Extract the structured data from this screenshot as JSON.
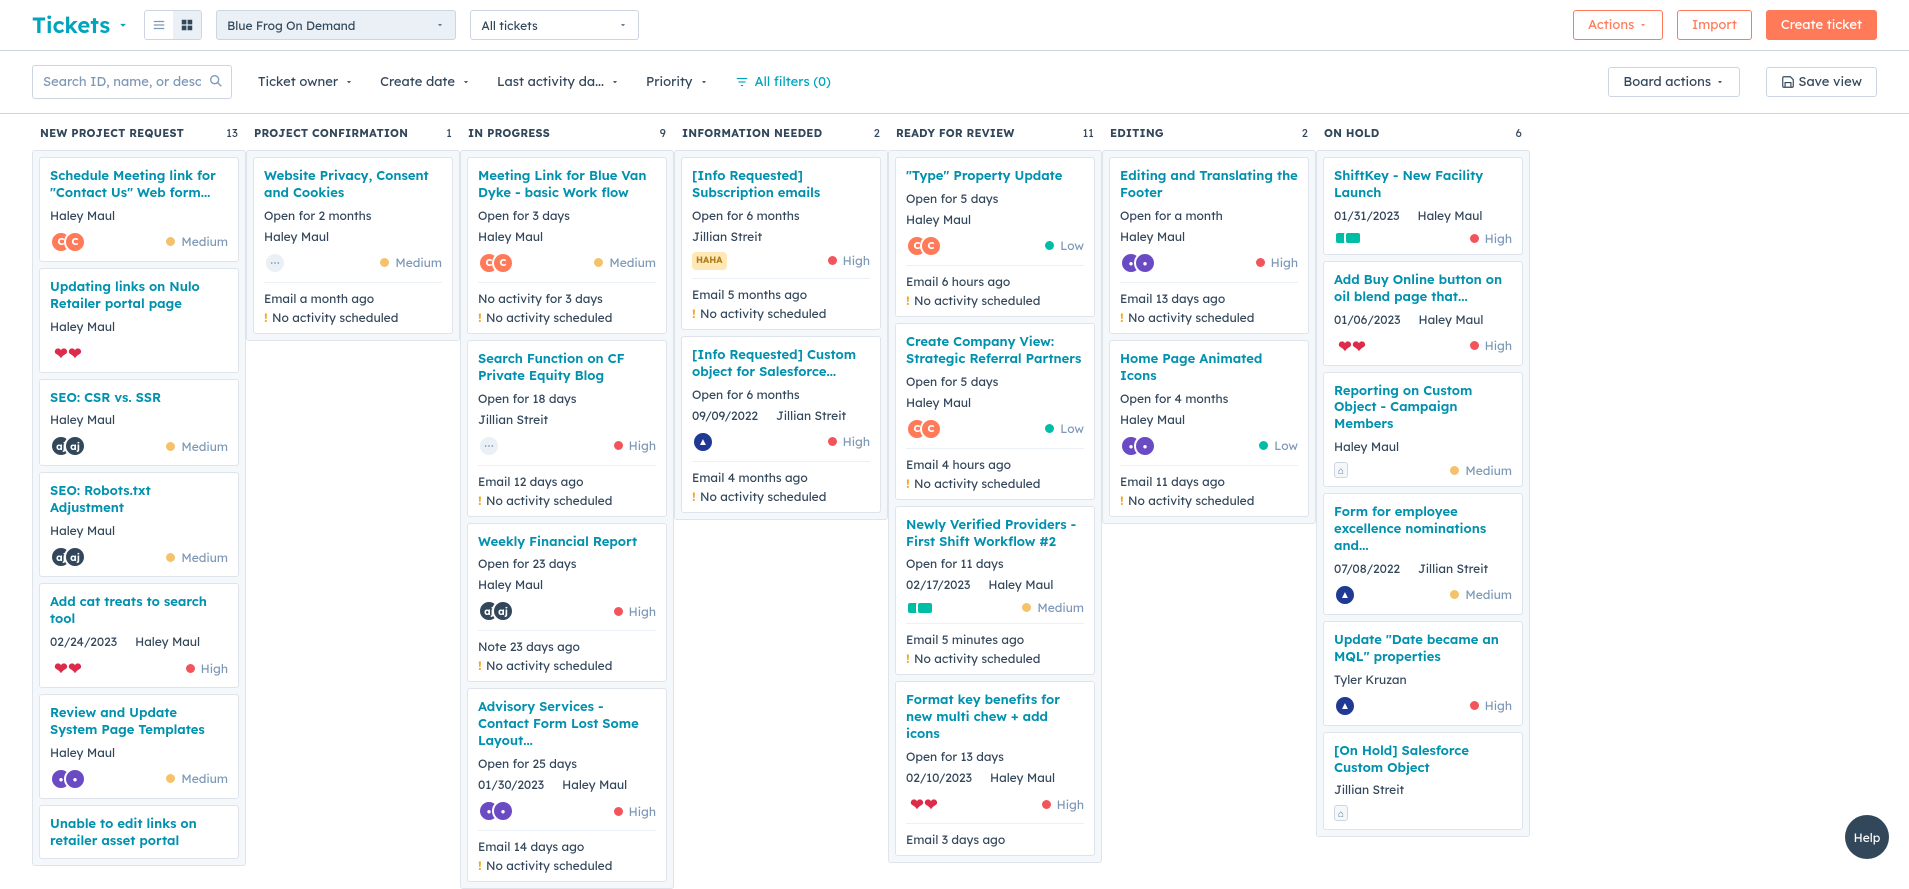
{
  "header": {
    "page_title": "Tickets",
    "pipeline_select": "Blue Frog On Demand",
    "view_select": "All tickets",
    "actions_label": "Actions",
    "import_label": "Import",
    "create_label": "Create ticket"
  },
  "filters": {
    "search_placeholder": "Search ID, name, or description",
    "owner": "Ticket owner",
    "create": "Create date",
    "activity": "Last activity da...",
    "priority": "Priority",
    "all_filters": "All filters (0)",
    "board_actions": "Board actions",
    "save_view": "Save view"
  },
  "columns": [
    {
      "name": "NEW PROJECT REQUEST",
      "count": 13,
      "cards": [
        {
          "title": "Schedule Meeting link for \"Contact Us\" Web form...",
          "line": "Haley Maul",
          "assoc": [
            {
              "t": "orangeC",
              "txt": "C"
            },
            {
              "t": "orangeC",
              "txt": "C"
            }
          ],
          "priority": "Medium"
        },
        {
          "title": "Updating links on Nulo Retailer portal page",
          "line": "Haley Maul",
          "assoc": [
            {
              "t": "heart",
              "txt": "❤"
            },
            {
              "t": "heart",
              "txt": "❤"
            }
          ]
        },
        {
          "title": "SEO: CSR vs. SSR",
          "line": "Haley Maul",
          "assoc": [
            {
              "t": "navyAJ",
              "txt": "aj"
            },
            {
              "t": "navyAJ",
              "txt": "aj"
            }
          ],
          "priority": "Medium"
        },
        {
          "title": "SEO: Robots.txt Adjustment",
          "line": "Haley Maul",
          "assoc": [
            {
              "t": "navyAJ",
              "txt": "aj"
            },
            {
              "t": "navyAJ",
              "txt": "aj"
            }
          ],
          "priority": "Medium"
        },
        {
          "title": "Add cat treats to search tool",
          "line2": [
            "02/24/2023",
            "Haley Maul"
          ],
          "assoc": [
            {
              "t": "heart",
              "txt": "❤"
            },
            {
              "t": "heart",
              "txt": "❤"
            }
          ],
          "priority": "High"
        },
        {
          "title": "Review and Update System Page Templates",
          "line": "Haley Maul",
          "assoc": [
            {
              "t": "purple",
              "txt": "●"
            },
            {
              "t": "purple",
              "txt": "●"
            }
          ],
          "priority": "Medium"
        },
        {
          "title": "Unable to edit links on retailer asset portal"
        }
      ]
    },
    {
      "name": "PROJECT CONFIRMATION",
      "count": 1,
      "cards": [
        {
          "title": "Website Privacy, Consent and Cookies",
          "line": "Open for 2 months",
          "line_b": "Haley Maul",
          "assoc": [
            {
              "t": "grey",
              "txt": "⋯"
            }
          ],
          "priority": "Medium",
          "meta": [
            "Email a month ago",
            "No activity scheduled"
          ]
        }
      ]
    },
    {
      "name": "IN PROGRESS",
      "count": 9,
      "cards": [
        {
          "title": "Meeting Link for Blue Van Dyke - basic Work flow",
          "line": "Open for 3 days",
          "line_b": "Haley Maul",
          "assoc": [
            {
              "t": "orangeC",
              "txt": "C"
            },
            {
              "t": "orangeC",
              "txt": "C"
            }
          ],
          "priority": "Medium",
          "meta": [
            "No activity for 3 days",
            "No activity scheduled"
          ]
        },
        {
          "title": "Search Function on CF Private Equity Blog",
          "line": "Open for 18 days",
          "line_b": "Jillian Streit",
          "assoc": [
            {
              "t": "grey",
              "txt": "⋯"
            }
          ],
          "priority": "High",
          "meta": [
            "Email 12 days ago",
            "No activity scheduled"
          ]
        },
        {
          "title": "Weekly Financial Report",
          "line": "Open for 23 days",
          "line_b": "Haley Maul",
          "assoc": [
            {
              "t": "navyAJ",
              "txt": "aj"
            },
            {
              "t": "navyAJ",
              "txt": "aj"
            }
          ],
          "priority": "High",
          "meta": [
            "Note 23 days ago",
            "No activity scheduled"
          ]
        },
        {
          "title": "Advisory Services - Contact Form Lost Some Layout...",
          "line": "Open for 25 days",
          "line2": [
            "01/30/2023",
            "Haley Maul"
          ],
          "assoc": [
            {
              "t": "purple",
              "txt": "●"
            },
            {
              "t": "purple",
              "txt": "●"
            }
          ],
          "priority": "High",
          "meta": [
            "Email 14 days ago",
            "No activity scheduled"
          ]
        }
      ]
    },
    {
      "name": "INFORMATION NEEDED",
      "count": 2,
      "cards": [
        {
          "title": "[Info Requested] Subscription emails",
          "line": "Open for 6 months",
          "line_b": "Jillian Streit",
          "assoc": [
            {
              "t": "haha",
              "txt": "HAHA"
            }
          ],
          "priority": "High",
          "meta": [
            "Email 5 months ago",
            "No activity scheduled"
          ]
        },
        {
          "title": "[Info Requested] Custom object for Salesforce...",
          "line": "Open for 6 months",
          "line2": [
            "09/09/2022",
            "Jillian Streit"
          ],
          "assoc": [
            {
              "t": "blueM",
              "txt": "▲"
            }
          ],
          "priority": "High",
          "meta": [
            "Email 4 months ago",
            "No activity scheduled"
          ]
        }
      ]
    },
    {
      "name": "READY FOR REVIEW",
      "count": 11,
      "cards": [
        {
          "title": "\"Type\" Property Update",
          "line": "Open for 5 days",
          "line_b": "Haley Maul",
          "assoc": [
            {
              "t": "orangeC",
              "txt": "C"
            },
            {
              "t": "orangeC",
              "txt": "C"
            }
          ],
          "priority": "Low",
          "meta": [
            "Email 6 hours ago",
            "No activity scheduled"
          ]
        },
        {
          "title": "Create Company View: Strategic Referral Partners",
          "line": "Open for 5 days",
          "line_b": "Haley Maul",
          "assoc": [
            {
              "t": "orangeC",
              "txt": "C"
            },
            {
              "t": "orangeC",
              "txt": "C"
            }
          ],
          "priority": "Low",
          "meta": [
            "Email 4 hours ago",
            "No activity scheduled"
          ]
        },
        {
          "title": "Newly Verified Providers - First Shift Workflow #2",
          "line": "Open for 11 days",
          "line2": [
            "02/17/2023",
            "Haley Maul"
          ],
          "assoc": [
            {
              "t": "greenS",
              "txt": ""
            },
            {
              "t": "greenS",
              "txt": ""
            }
          ],
          "priority": "Medium",
          "meta": [
            "Email 5 minutes ago",
            "No activity scheduled"
          ]
        },
        {
          "title": "Format key benefits for new multi chew + add icons",
          "line": "Open for 13 days",
          "line2": [
            "02/10/2023",
            "Haley Maul"
          ],
          "assoc": [
            {
              "t": "heart",
              "txt": "❤"
            },
            {
              "t": "heart",
              "txt": "❤"
            }
          ],
          "priority": "High",
          "meta": [
            "Email 3 days ago"
          ]
        }
      ]
    },
    {
      "name": "EDITING",
      "count": 2,
      "cards": [
        {
          "title": "Editing and Translating the Footer",
          "line": "Open for a month",
          "line_b": "Haley Maul",
          "assoc": [
            {
              "t": "purple",
              "txt": "●"
            },
            {
              "t": "purple",
              "txt": "●"
            }
          ],
          "priority": "High",
          "meta": [
            "Email 13 days ago",
            "No activity scheduled"
          ]
        },
        {
          "title": "Home Page Animated Icons",
          "line": "Open for 4 months",
          "line_b": "Haley Maul",
          "assoc": [
            {
              "t": "purple",
              "txt": "●"
            },
            {
              "t": "purple",
              "txt": "●"
            }
          ],
          "priority": "Low",
          "meta": [
            "Email 11 days ago",
            "No activity scheduled"
          ]
        }
      ]
    },
    {
      "name": "ON HOLD",
      "count": 6,
      "cards": [
        {
          "title": "ShiftKey - New Facility Launch",
          "line2": [
            "01/31/2023",
            "Haley Maul"
          ],
          "assoc": [
            {
              "t": "greenS",
              "txt": ""
            },
            {
              "t": "greenS",
              "txt": ""
            }
          ],
          "priority": "High"
        },
        {
          "title": "Add Buy Online button on oil blend page that...",
          "line2": [
            "01/06/2023",
            "Haley Maul"
          ],
          "assoc": [
            {
              "t": "heart",
              "txt": "❤"
            },
            {
              "t": "heart",
              "txt": "❤"
            }
          ],
          "priority": "High"
        },
        {
          "title": "Reporting on Custom Object - Campaign Members",
          "line": "Haley Maul",
          "assoc": [
            {
              "t": "key",
              "txt": "⌂"
            }
          ],
          "priority": "Medium"
        },
        {
          "title": "Form for employee excellence nominations and...",
          "line2": [
            "07/08/2022",
            "Jillian Streit"
          ],
          "assoc": [
            {
              "t": "blueM",
              "txt": "▲"
            }
          ],
          "priority": "Medium"
        },
        {
          "title": "Update \"Date became an MQL\" properties",
          "line": "Tyler Kruzan",
          "assoc": [
            {
              "t": "blueM",
              "txt": "▲"
            }
          ],
          "priority": "High"
        },
        {
          "title": "[On Hold] Salesforce Custom Object",
          "line": "Jillian Streit",
          "assoc": [
            {
              "t": "key",
              "txt": "⌂"
            }
          ]
        }
      ]
    }
  ],
  "help_label": "Help"
}
